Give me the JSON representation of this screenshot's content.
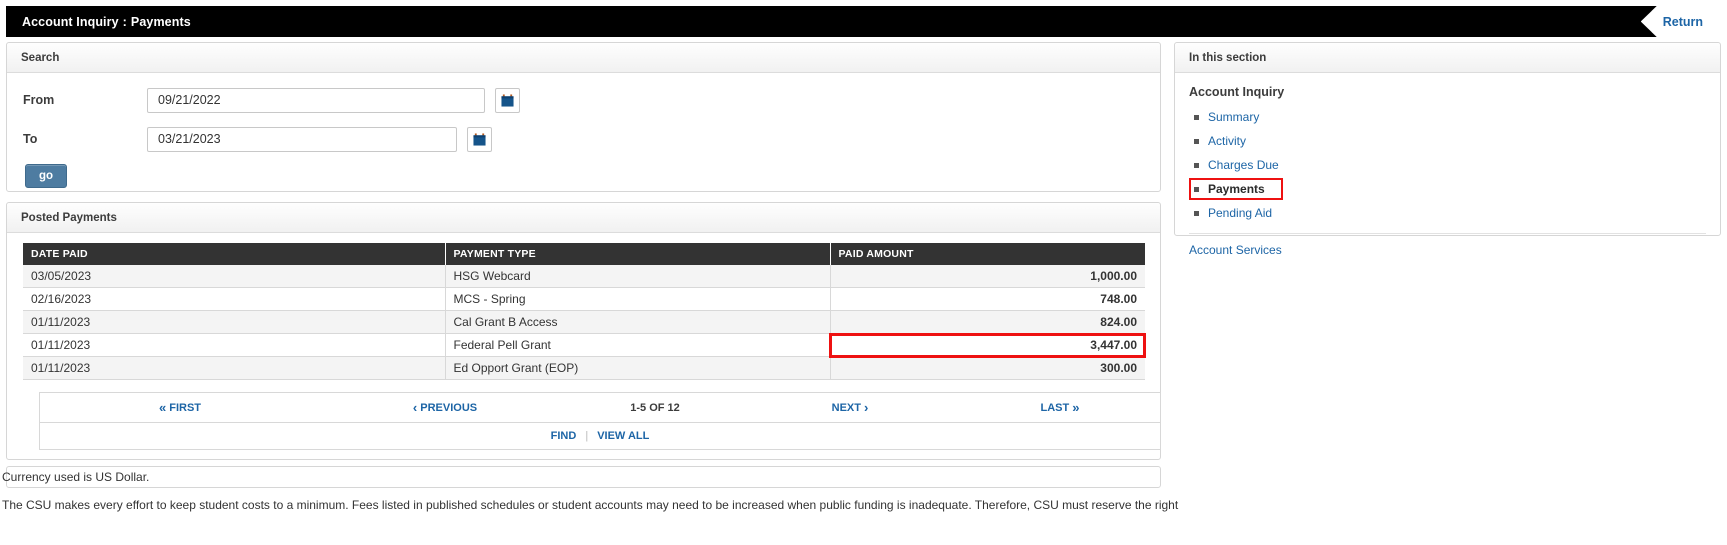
{
  "topbar": {
    "breadcrumb_parent": "Account Inquiry",
    "breadcrumb_separator": ":",
    "breadcrumb_current": "Payments",
    "return_label": "Return"
  },
  "search": {
    "panel_title": "Search",
    "from_label": "From",
    "from_value": "09/21/2022",
    "to_label": "To",
    "to_value": "03/21/2023",
    "go_label": "go",
    "calendar_icon": "calendar-icon"
  },
  "posted_payments": {
    "panel_title": "Posted Payments",
    "columns": [
      "DATE PAID",
      "PAYMENT TYPE",
      "PAID AMOUNT"
    ],
    "rows": [
      {
        "date": "03/05/2023",
        "type": "HSG Webcard",
        "amount": "1,000.00",
        "highlight": false
      },
      {
        "date": "02/16/2023",
        "type": "MCS - Spring",
        "amount": "748.00",
        "highlight": false
      },
      {
        "date": "01/11/2023",
        "type": "Cal Grant B Access",
        "amount": "824.00",
        "highlight": false
      },
      {
        "date": "01/11/2023",
        "type": "Federal Pell Grant",
        "amount": "3,447.00",
        "highlight": true
      },
      {
        "date": "01/11/2023",
        "type": "Ed Opport Grant (EOP)",
        "amount": "300.00",
        "highlight": false
      }
    ],
    "pager": {
      "first": "FIRST",
      "previous": "PREVIOUS",
      "count": "1-5 OF 12",
      "next": "NEXT",
      "last": "LAST"
    },
    "find_label": "FIND",
    "view_all_label": "VIEW ALL"
  },
  "sidebar": {
    "panel_title": "In this section",
    "group_title": "Account Inquiry",
    "items": [
      {
        "label": "Summary",
        "active": false
      },
      {
        "label": "Activity",
        "active": false
      },
      {
        "label": "Charges Due",
        "active": false
      },
      {
        "label": "Payments",
        "active": true
      },
      {
        "label": "Pending Aid",
        "active": false
      }
    ],
    "account_services": "Account Services"
  },
  "footer": {
    "line1": "Currency used is US Dollar.",
    "line2": "The CSU makes every effort to keep student costs to a minimum. Fees listed in published schedules or student accounts may need to be increased when public funding is inadequate. Therefore, CSU must reserve the right"
  },
  "colors": {
    "accent_blue": "#1d65a6",
    "highlight_red": "#ee1111",
    "header_black": "#000000",
    "table_header": "#333333",
    "go_button": "#4e7ca1"
  }
}
